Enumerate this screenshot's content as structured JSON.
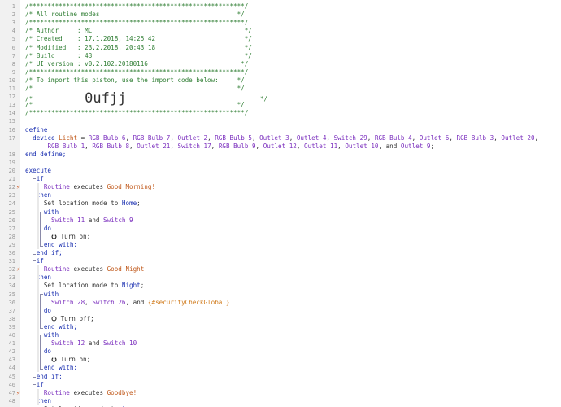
{
  "editor": {
    "lines": [
      {
        "n": "1",
        "mark": "",
        "parts": [
          [
            "cmt",
            "/**********************************************************/"
          ]
        ]
      },
      {
        "n": "2",
        "mark": "",
        "parts": [
          [
            "cmt",
            "/* All routine modes                                     */"
          ]
        ]
      },
      {
        "n": "3",
        "mark": "",
        "parts": [
          [
            "cmt",
            "/**********************************************************/"
          ]
        ]
      },
      {
        "n": "4",
        "mark": "",
        "parts": [
          [
            "cmt",
            "/* Author     : MC                                         */"
          ]
        ]
      },
      {
        "n": "5",
        "mark": "",
        "parts": [
          [
            "cmt",
            "/* Created    : 17.1.2018, 14:25:42                        */"
          ]
        ]
      },
      {
        "n": "6",
        "mark": "",
        "parts": [
          [
            "cmt",
            "/* Modified   : 23.2.2018, 20:43:18                        */"
          ]
        ]
      },
      {
        "n": "7",
        "mark": "",
        "parts": [
          [
            "cmt",
            "/* Build      : 43                                         */"
          ]
        ]
      },
      {
        "n": "8",
        "mark": "",
        "parts": [
          [
            "cmt",
            "/* UI version : v0.2.102.20180116                         */"
          ]
        ]
      },
      {
        "n": "9",
        "mark": "",
        "parts": [
          [
            "cmt",
            "/**********************************************************/"
          ]
        ]
      },
      {
        "n": "10",
        "mark": "",
        "parts": [
          [
            "cmt",
            "/* To import this piston, use the import code below:     */"
          ]
        ]
      },
      {
        "n": "11",
        "mark": "",
        "parts": [
          [
            "cmt",
            "/*                                                       */"
          ]
        ]
      },
      {
        "n": "12",
        "mark": "",
        "parts": [
          [
            "cmt",
            "/*              "
          ],
          [
            "big",
            "0ufjj"
          ],
          [
            "cmt",
            "                                    */"
          ]
        ]
      },
      {
        "n": "13",
        "mark": "",
        "parts": [
          [
            "cmt",
            "/*                                                       */"
          ]
        ]
      },
      {
        "n": "14",
        "mark": "",
        "parts": [
          [
            "cmt",
            "/**********************************************************/"
          ]
        ]
      },
      {
        "n": "15",
        "mark": "",
        "parts": []
      },
      {
        "n": "16",
        "mark": "",
        "parts": [
          [
            "kw",
            "define"
          ]
        ]
      },
      {
        "n": "17",
        "mark": "",
        "parts": [
          [
            "plain",
            "  "
          ],
          [
            "kw",
            "device "
          ],
          [
            "orange",
            "Licht"
          ],
          [
            "plain",
            " = "
          ],
          [
            "dev",
            "RGB Bulb 6"
          ],
          [
            "plain",
            ", "
          ],
          [
            "dev",
            "RGB Bulb 7"
          ],
          [
            "plain",
            ", "
          ],
          [
            "dev",
            "Outlet 2"
          ],
          [
            "plain",
            ", "
          ],
          [
            "dev",
            "RGB Bulb 5"
          ],
          [
            "plain",
            ", "
          ],
          [
            "dev",
            "Outlet 3"
          ],
          [
            "plain",
            ", "
          ],
          [
            "dev",
            "Outlet 4"
          ],
          [
            "plain",
            ", "
          ],
          [
            "dev",
            "Switch 29"
          ],
          [
            "plain",
            ", "
          ],
          [
            "dev",
            "RGB Bulb 4"
          ],
          [
            "plain",
            ", "
          ],
          [
            "dev",
            "Outlet 6"
          ],
          [
            "plain",
            ", "
          ],
          [
            "dev",
            "RGB Bulb 3"
          ],
          [
            "plain",
            ", "
          ],
          [
            "dev",
            "Outlet 20"
          ],
          [
            "plain",
            ","
          ]
        ]
      },
      {
        "n": "",
        "mark": "",
        "parts": [
          [
            "plain",
            "      "
          ],
          [
            "dev",
            "RGB Bulb 1"
          ],
          [
            "plain",
            ", "
          ],
          [
            "dev",
            "RGB Bulb 8"
          ],
          [
            "plain",
            ", "
          ],
          [
            "dev",
            "Outlet 21"
          ],
          [
            "plain",
            ", "
          ],
          [
            "dev",
            "Switch 17"
          ],
          [
            "plain",
            ", "
          ],
          [
            "dev",
            "RGB Bulb 9"
          ],
          [
            "plain",
            ", "
          ],
          [
            "dev",
            "Outlet 12"
          ],
          [
            "plain",
            ", "
          ],
          [
            "dev",
            "Outlet 11"
          ],
          [
            "plain",
            ", "
          ],
          [
            "dev",
            "Outlet 10"
          ],
          [
            "plain",
            ", and "
          ],
          [
            "dev",
            "Outlet 9"
          ],
          [
            "plain",
            ";"
          ]
        ]
      },
      {
        "n": "18",
        "mark": "",
        "parts": [
          [
            "kw",
            "end define;"
          ]
        ]
      },
      {
        "n": "19",
        "mark": "",
        "parts": []
      },
      {
        "n": "20",
        "mark": "",
        "parts": [
          [
            "kw",
            "execute"
          ]
        ]
      },
      {
        "n": "21",
        "mark": "",
        "parts": [
          [
            "plain",
            "   "
          ],
          [
            "kw",
            "if"
          ]
        ]
      },
      {
        "n": "22",
        "mark": "⚡",
        "parts": [
          [
            "plain",
            "     "
          ],
          [
            "dev",
            "Routine"
          ],
          [
            "plain",
            " executes "
          ],
          [
            "orange",
            "Good Morning!"
          ]
        ]
      },
      {
        "n": "23",
        "mark": "",
        "parts": [
          [
            "plain",
            "   "
          ],
          [
            "kw",
            "then"
          ]
        ]
      },
      {
        "n": "24",
        "mark": "",
        "parts": [
          [
            "plain",
            "     Set location mode to "
          ],
          [
            "str",
            "Home"
          ],
          [
            "plain",
            ";"
          ]
        ]
      },
      {
        "n": "25",
        "mark": "",
        "parts": [
          [
            "plain",
            "     "
          ],
          [
            "kw",
            "with"
          ]
        ]
      },
      {
        "n": "26",
        "mark": "",
        "parts": [
          [
            "plain",
            "       "
          ],
          [
            "dev",
            "Switch 11"
          ],
          [
            "plain",
            " and "
          ],
          [
            "dev",
            "Switch 9"
          ]
        ]
      },
      {
        "n": "27",
        "mark": "",
        "parts": [
          [
            "plain",
            "     "
          ],
          [
            "kw",
            "do"
          ]
        ]
      },
      {
        "n": "28",
        "mark": "",
        "parts": [
          [
            "plain",
            "       "
          ],
          [
            "pwr",
            "on"
          ],
          [
            "plain",
            " Turn on;"
          ]
        ]
      },
      {
        "n": "29",
        "mark": "",
        "parts": [
          [
            "plain",
            "     "
          ],
          [
            "kw",
            "end with;"
          ]
        ]
      },
      {
        "n": "30",
        "mark": "",
        "parts": [
          [
            "plain",
            "   "
          ],
          [
            "kw",
            "end if;"
          ]
        ]
      },
      {
        "n": "31",
        "mark": "",
        "parts": [
          [
            "plain",
            "   "
          ],
          [
            "kw",
            "if"
          ]
        ]
      },
      {
        "n": "32",
        "mark": "⚡",
        "parts": [
          [
            "plain",
            "     "
          ],
          [
            "dev",
            "Routine"
          ],
          [
            "plain",
            " executes "
          ],
          [
            "orange",
            "Good Night"
          ]
        ]
      },
      {
        "n": "33",
        "mark": "",
        "parts": [
          [
            "plain",
            "   "
          ],
          [
            "kw",
            "then"
          ]
        ]
      },
      {
        "n": "34",
        "mark": "",
        "parts": [
          [
            "plain",
            "     Set location mode to "
          ],
          [
            "str",
            "Night"
          ],
          [
            "plain",
            ";"
          ]
        ]
      },
      {
        "n": "35",
        "mark": "",
        "parts": [
          [
            "plain",
            "     "
          ],
          [
            "kw",
            "with"
          ]
        ]
      },
      {
        "n": "36",
        "mark": "",
        "parts": [
          [
            "plain",
            "       "
          ],
          [
            "dev",
            "Switch 28"
          ],
          [
            "plain",
            ", "
          ],
          [
            "dev",
            "Switch 26"
          ],
          [
            "plain",
            ", and "
          ],
          [
            "gv",
            "{#securityCheckGlobal}"
          ]
        ]
      },
      {
        "n": "37",
        "mark": "",
        "parts": [
          [
            "plain",
            "     "
          ],
          [
            "kw",
            "do"
          ]
        ]
      },
      {
        "n": "38",
        "mark": "",
        "parts": [
          [
            "plain",
            "       "
          ],
          [
            "pwr",
            "off"
          ],
          [
            "plain",
            " Turn off;"
          ]
        ]
      },
      {
        "n": "39",
        "mark": "",
        "parts": [
          [
            "plain",
            "     "
          ],
          [
            "kw",
            "end with;"
          ]
        ]
      },
      {
        "n": "40",
        "mark": "",
        "parts": [
          [
            "plain",
            "     "
          ],
          [
            "kw",
            "with"
          ]
        ]
      },
      {
        "n": "41",
        "mark": "",
        "parts": [
          [
            "plain",
            "       "
          ],
          [
            "dev",
            "Switch 12"
          ],
          [
            "plain",
            " and "
          ],
          [
            "dev",
            "Switch 10"
          ]
        ]
      },
      {
        "n": "42",
        "mark": "",
        "parts": [
          [
            "plain",
            "     "
          ],
          [
            "kw",
            "do"
          ]
        ]
      },
      {
        "n": "43",
        "mark": "",
        "parts": [
          [
            "plain",
            "       "
          ],
          [
            "pwr",
            "on"
          ],
          [
            "plain",
            " Turn on;"
          ]
        ]
      },
      {
        "n": "44",
        "mark": "",
        "parts": [
          [
            "plain",
            "     "
          ],
          [
            "kw",
            "end with;"
          ]
        ]
      },
      {
        "n": "45",
        "mark": "",
        "parts": [
          [
            "plain",
            "   "
          ],
          [
            "kw",
            "end if;"
          ]
        ]
      },
      {
        "n": "46",
        "mark": "",
        "parts": [
          [
            "plain",
            "   "
          ],
          [
            "kw",
            "if"
          ]
        ]
      },
      {
        "n": "47",
        "mark": "⚡",
        "parts": [
          [
            "plain",
            "     "
          ],
          [
            "dev",
            "Routine"
          ],
          [
            "plain",
            " executes "
          ],
          [
            "orange",
            "Goodbye!"
          ]
        ]
      },
      {
        "n": "48",
        "mark": "",
        "parts": [
          [
            "plain",
            "   "
          ],
          [
            "kw",
            "then"
          ]
        ]
      },
      {
        "n": "49",
        "mark": "",
        "parts": [
          [
            "plain",
            "     Set location mode to "
          ],
          [
            "str",
            "Away"
          ],
          [
            "plain",
            ";"
          ]
        ]
      }
    ]
  }
}
